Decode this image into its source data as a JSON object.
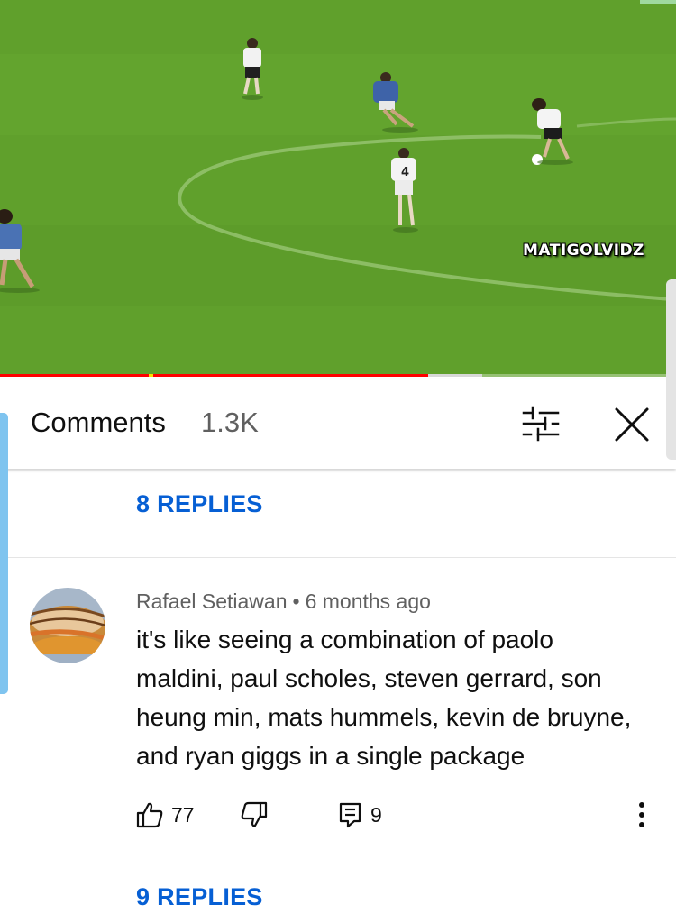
{
  "video": {
    "watermark": "MATIGOLVIDZ",
    "progress_played": 0.633,
    "progress_buffered": 0.713
  },
  "comments_header": {
    "title": "Comments",
    "count": "1.3K",
    "filter_icon": "filter-sliders-icon",
    "close_icon": "close-icon"
  },
  "thread_above": {
    "replies_label": "8 REPLIES"
  },
  "comment": {
    "author": "Rafael Setiawan",
    "separator": "•",
    "time": "6 months ago",
    "lines": [
      "it's like seeing a combination of paolo",
      "maldini, paul scholes, steven gerrard, son",
      "heung min, mats hummels, kevin de bruyne,",
      "and ryan giggs in a single package"
    ],
    "likes": "77",
    "reply_count": "9",
    "replies_label": "9 REPLIES",
    "icons": {
      "like": "thumbs-up-icon",
      "dislike": "thumbs-down-icon",
      "reply": "comment-icon",
      "more": "more-vertical-icon"
    }
  },
  "colors": {
    "link_blue": "#065fd4",
    "progress_red": "#ff0000",
    "pitch_green": "#62a02d",
    "edge_blue": "#7fc4ef"
  }
}
